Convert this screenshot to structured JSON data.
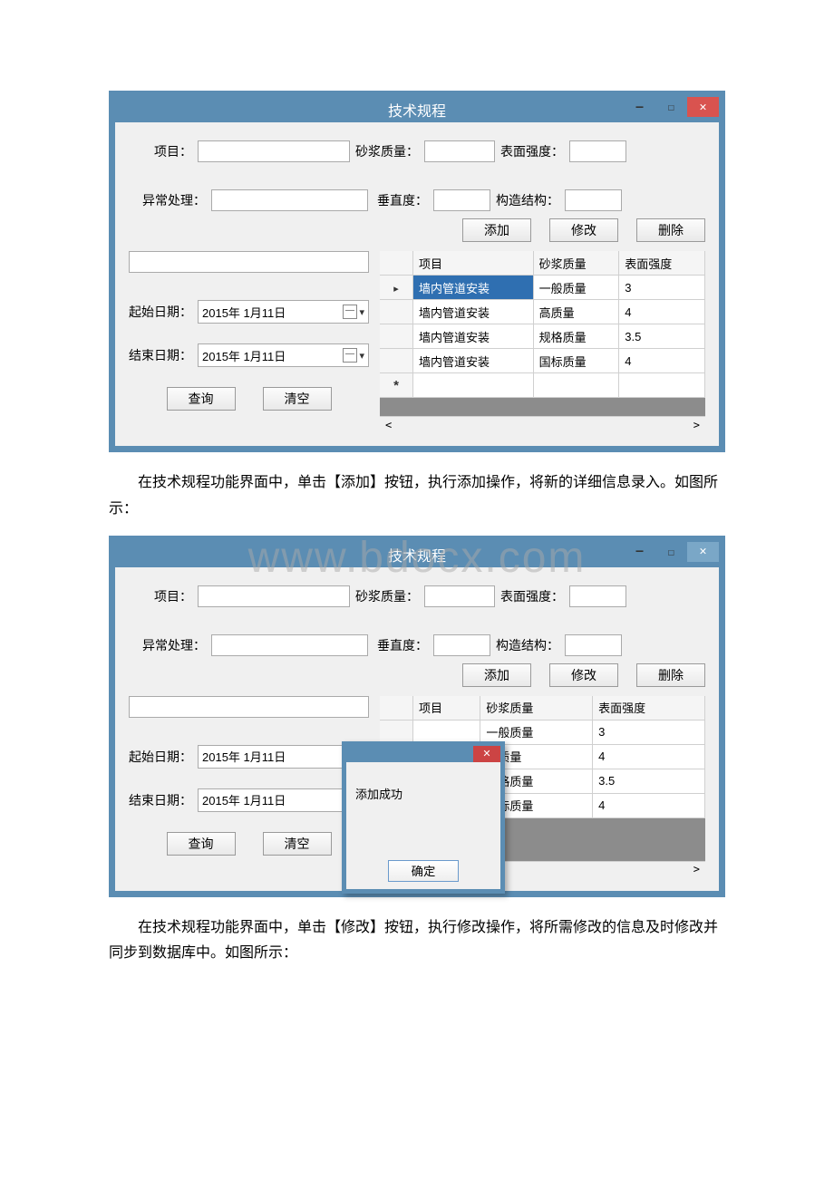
{
  "watermark": "www.bdocx.com",
  "para1": "在技术规程功能界面中，单击【添加】按钮，执行添加操作，将新的详细信息录入。如图所示：",
  "para2": "在技术规程功能界面中，单击【修改】按钮，执行修改操作，将所需修改的信息及时修改并同步到数据库中。如图所示：",
  "window": {
    "title": "技术规程",
    "form": {
      "project_label": "项目：",
      "project_value": "",
      "mortar_label": "砂浆质量：",
      "mortar_value": "",
      "surface_label": "表面强度：",
      "surface_value": "",
      "exception_label": "异常处理：",
      "exception_value": "",
      "vertical_label": "垂直度：",
      "vertical_value": "",
      "struct_label": "构造结构：",
      "struct_value": ""
    },
    "buttons": {
      "add": "添加",
      "modify": "修改",
      "delete": "删除",
      "query": "查询",
      "clear": "清空"
    },
    "date": {
      "start_label": "起始日期：",
      "start_value": "2015年 1月11日",
      "end_label": "结束日期：",
      "end_value": "2015年 1月11日"
    },
    "grid": {
      "headers": {
        "project": "项目",
        "mortar": "砂浆质量",
        "surface": "表面强度"
      },
      "rows": [
        {
          "project": "墙内管道安装",
          "mortar": "一般质量",
          "surface": "3"
        },
        {
          "project": "墙内管道安装",
          "mortar": "高质量",
          "surface": "4"
        },
        {
          "project": "墙内管道安装",
          "mortar": "规格质量",
          "surface": "3.5"
        },
        {
          "project": "墙内管道安装",
          "mortar": "国标质量",
          "surface": "4"
        }
      ]
    },
    "search_value": ""
  },
  "modal": {
    "msg": "添加成功",
    "ok": "确定"
  }
}
